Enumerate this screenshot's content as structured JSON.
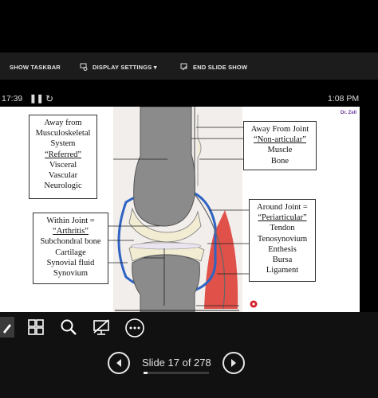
{
  "toolbar": {
    "show_taskbar": "SHOW TASKBAR",
    "display_settings": "DISPLAY SETTINGS ▾",
    "end_slide_show": "END SLIDE SHOW"
  },
  "status": {
    "elapsed_time": "17:39",
    "clock": "1:08 PM"
  },
  "slide": {
    "corner_label": "Dr. Zell",
    "box_away_from_msk": [
      "Away from",
      "Musculoskeletal",
      "System",
      "“Referred”",
      "Visceral",
      "Vascular",
      "Neurologic"
    ],
    "box_within_joint": [
      "Within Joint =",
      "“Arthritis”",
      "Subchondral bone",
      "Cartilage",
      "Synovial fluid",
      "Synovium"
    ],
    "box_away_from_joint": [
      "Away From Joint",
      "“Non-articular”",
      "Muscle",
      "Bone"
    ],
    "box_around_joint": [
      "Around Joint =",
      "“Periarticular”",
      "Tendon",
      "Tenosynovium",
      "Enthesis",
      "Bursa",
      "Ligament"
    ]
  },
  "presenter": {
    "slide_counter": "Slide 17 of 278",
    "progress": 0.061
  },
  "colors": {
    "bone": "#8b8b8c",
    "cartilage": "#f2ecd2",
    "synovium": "#2e63c4",
    "muscle": "#e0514a",
    "laser": "#d61e2b"
  }
}
